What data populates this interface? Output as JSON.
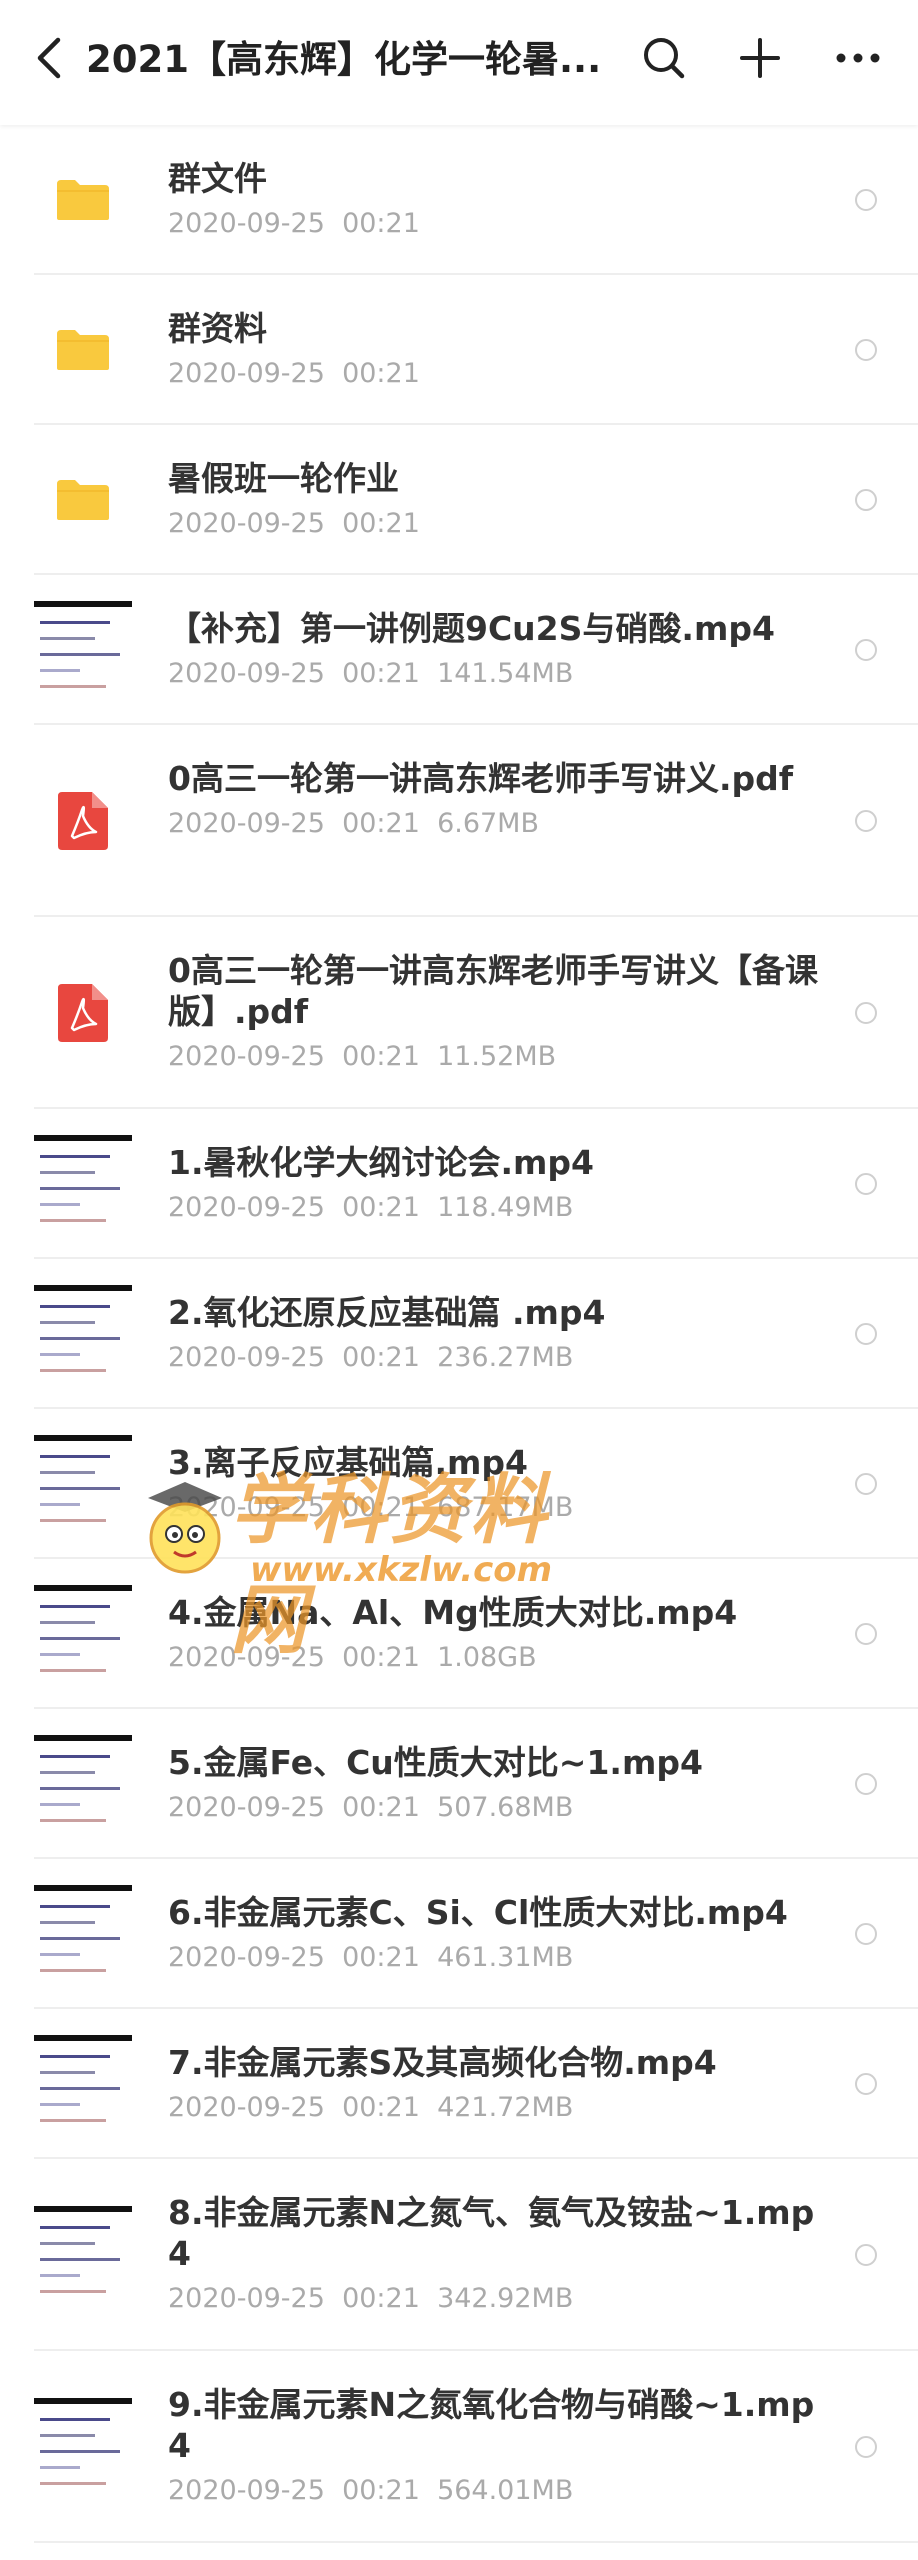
{
  "header": {
    "title": "2021【高东辉】化学一轮暑...",
    "back_icon": "chevron-left-icon",
    "search_icon": "search-icon",
    "add_icon": "plus-icon",
    "more_icon": "more-dots-icon"
  },
  "files": [
    {
      "name": "群文件",
      "date": "2020-09-25  00:21",
      "size": "",
      "type": "folder"
    },
    {
      "name": "群资料",
      "date": "2020-09-25  00:21",
      "size": "",
      "type": "folder"
    },
    {
      "name": "暑假班一轮作业",
      "date": "2020-09-25  00:21",
      "size": "",
      "type": "folder"
    },
    {
      "name": "【补充】第一讲例题9Cu2S与硝酸.mp4",
      "date": "2020-09-25  00:21",
      "size": "141.54MB",
      "type": "video"
    },
    {
      "name": "0高三一轮第一讲高东辉老师手写讲义.pdf",
      "date": "2020-09-25  00:21",
      "size": "6.67MB",
      "type": "pdf"
    },
    {
      "name": "0高三一轮第一讲高东辉老师手写讲义【备课版】.pdf",
      "date": "2020-09-25  00:21",
      "size": "11.52MB",
      "type": "pdf"
    },
    {
      "name": "1.暑秋化学大纲讨论会.mp4",
      "date": "2020-09-25  00:21",
      "size": "118.49MB",
      "type": "video"
    },
    {
      "name": "2.氧化还原反应基础篇 .mp4",
      "date": "2020-09-25  00:21",
      "size": "236.27MB",
      "type": "video"
    },
    {
      "name": "3.离子反应基础篇.mp4",
      "date": "2020-09-25  00:21",
      "size": "687.17MB",
      "type": "video"
    },
    {
      "name": "4.金属Na、Al、Mg性质大对比.mp4",
      "date": "2020-09-25  00:21",
      "size": "1.08GB",
      "type": "video"
    },
    {
      "name": "5.金属Fe、Cu性质大对比~1.mp4",
      "date": "2020-09-25  00:21",
      "size": "507.68MB",
      "type": "video"
    },
    {
      "name": "6.非金属元素C、Si、Cl性质大对比.mp4",
      "date": "2020-09-25  00:21",
      "size": "461.31MB",
      "type": "video"
    },
    {
      "name": "7.非金属元素S及其高频化合物.mp4",
      "date": "2020-09-25  00:21",
      "size": "421.72MB",
      "type": "video"
    },
    {
      "name": "8.非金属元素N之氮气、氨气及铵盐~1.mp4",
      "date": "2020-09-25  00:21",
      "size": "342.92MB",
      "type": "video"
    },
    {
      "name": "9.非金属元素N之氮氧化合物与硝酸~1.mp4",
      "date": "2020-09-25  00:21",
      "size": "564.01MB",
      "type": "video"
    }
  ],
  "watermark": {
    "text": "学科资料网",
    "url": "www.xkzlw.com"
  },
  "colors": {
    "folder": "#F9C93E",
    "pdf": "#E8473F",
    "radio_border": "#CFCFCF",
    "divider": "#EEEEEE"
  }
}
